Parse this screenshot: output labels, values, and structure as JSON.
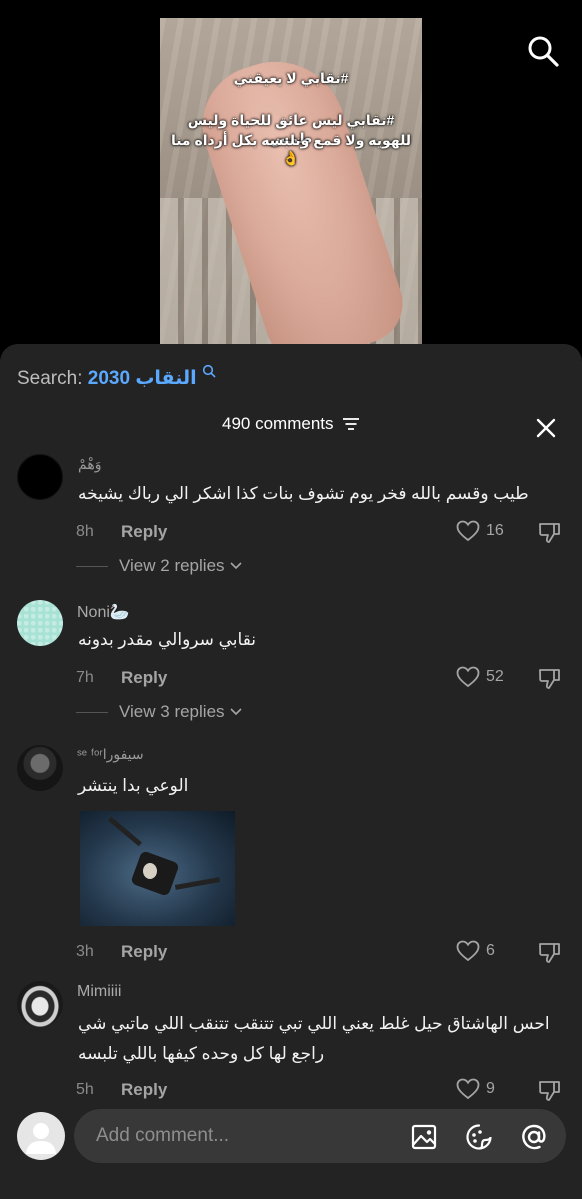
{
  "video": {
    "caption_line1": "#نقابي لا يعيقني",
    "caption_line2": "#نقابي ليس عائق للحياة وليس طمس",
    "caption_line3": "للهويه ولا قمع ونلبسه بكل أرداه منا 👌"
  },
  "search": {
    "prefix": "Search:",
    "term": "2030 النقاب"
  },
  "comments_header": {
    "count_label": "490 comments"
  },
  "comments": [
    {
      "username": "وَهْمْ",
      "text": "طيب وقسم بالله فخر يوم تشوف بنات كذا اشكر الي رباك يشيخه",
      "time": "8h",
      "reply_label": "Reply",
      "likes": "16",
      "view_replies": "View 2 replies"
    },
    {
      "username": "Noni🦢",
      "text": "نقابي سروالي مقدر بدونه",
      "time": "7h",
      "reply_label": "Reply",
      "likes": "52",
      "view_replies": "View 3 replies"
    },
    {
      "username": "ˢᵉ ᶠᵒʳسيفورا",
      "text": "الوعي بدا ينتشر",
      "time": "3h",
      "reply_label": "Reply",
      "likes": "6"
    },
    {
      "username": "Mimiiii",
      "text_line1": "احس الهاشتاق حيل غلط يعني اللي تبي تتنقب تتنقب اللي ماتبي شي",
      "text_line2": "راجع لها كل وحده كيفها باللي تلبسه",
      "time": "5h",
      "reply_label": "Reply",
      "likes": "9"
    }
  ],
  "composer": {
    "placeholder": "Add comment..."
  },
  "colors": {
    "sheet_bg": "#232323",
    "accent_link": "#5ba8ff",
    "input_bg": "#383838"
  }
}
